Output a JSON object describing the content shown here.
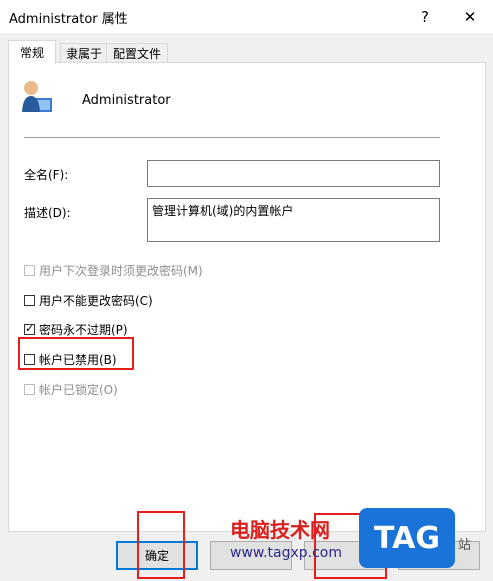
{
  "window": {
    "title": "Administrator 属性",
    "help_glyph": "?",
    "close_glyph": "✕"
  },
  "tabs": [
    {
      "label": "常规",
      "active": true
    },
    {
      "label": "隶属于",
      "active": false
    },
    {
      "label": "配置文件",
      "active": false
    }
  ],
  "user": {
    "name": "Administrator",
    "icon": "user-icon"
  },
  "fields": {
    "fullname_label": "全名(F):",
    "fullname_value": "",
    "desc_label": "描述(D):",
    "desc_value": "管理计算机(域)的内置帐户"
  },
  "options": [
    {
      "label": "用户下次登录时须更改密码(M)",
      "checked": false,
      "disabled": true
    },
    {
      "label": "用户不能更改密码(C)",
      "checked": false,
      "disabled": false
    },
    {
      "label": "密码永不过期(P)",
      "checked": true,
      "disabled": false
    },
    {
      "label": "帐户已禁用(B)",
      "checked": false,
      "disabled": false
    },
    {
      "label": "帐户已锁定(O)",
      "checked": false,
      "disabled": true
    }
  ],
  "buttons": {
    "ok": "确定",
    "cancel": "",
    "apply": "",
    "help": ""
  },
  "watermark": {
    "site_cn": "电脑技术网",
    "site_url": "www.tagxp.com",
    "logo": "TAG",
    "suffix": "站"
  },
  "colors": {
    "highlight": "#e61e1e",
    "accent": "#0078d7"
  }
}
